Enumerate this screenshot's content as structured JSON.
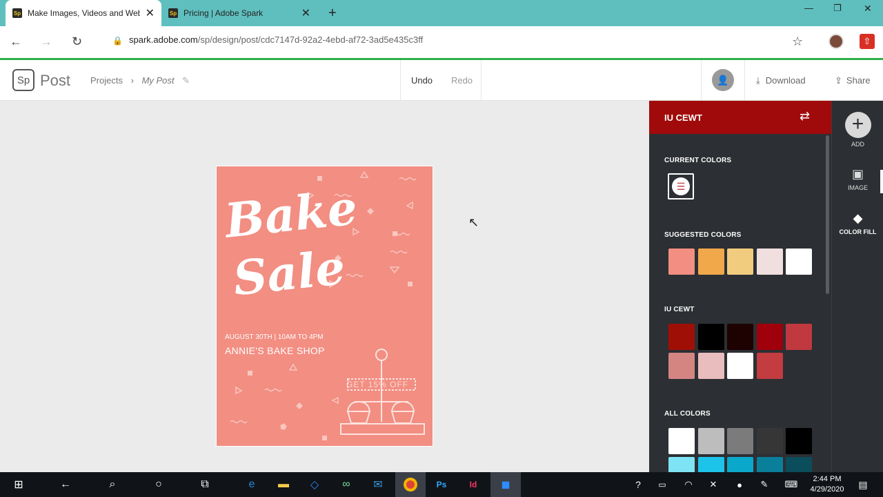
{
  "browser": {
    "tabs": [
      {
        "title": "Make Images, Videos and Web",
        "favicon": "Sp"
      },
      {
        "title": "Pricing | Adobe Spark",
        "favicon": "Sp"
      }
    ],
    "new_tab": "+",
    "url_host": "spark.adobe.com",
    "url_path": "/sp/design/post/cdc7147d-92a2-4ebd-af72-3ad5e435c3ff",
    "colors": {
      "tabbar": "#5fbfbf",
      "progress": "#2fb04b"
    }
  },
  "app": {
    "logo": "Sp",
    "logo_text": "Post",
    "breadcrumb": {
      "parent": "Projects",
      "separator": "›",
      "current": "My Post"
    },
    "undo": "Undo",
    "redo": "Redo",
    "download": "Download",
    "share": "Share"
  },
  "poster": {
    "title_line1": "Bake",
    "title_line2": "Sale",
    "date_line": "AUGUST 30TH | 10AM TO 4PM",
    "shop_line": "ANNIE'S BAKE SHOP",
    "promo": "GET 15% OFF",
    "background": "#f28e82"
  },
  "panel": {
    "title": "IU CEWT",
    "current_label": "CURRENT COLORS",
    "current_colors": [
      "#f28e82"
    ],
    "suggested_label": "SUGGESTED COLORS",
    "suggested_colors": [
      "#f28e82",
      "#f0a84a",
      "#f2cc7e",
      "#f1dede",
      "#ffffff"
    ],
    "theme_label": "IU CEWT",
    "theme_colors": [
      "#a00f05",
      "#000000",
      "#1e0202",
      "#a0000b",
      "#c0393f",
      "#d48582",
      "#e9bdbd",
      "#ffffff",
      "#c23c40"
    ],
    "all_label": "ALL COLORS",
    "all_colors": [
      "#ffffff",
      "#bdbdbd",
      "#7b7b7b",
      "#363636",
      "#000000",
      "#7ee3f5",
      "#1ec3ea",
      "#0aa9cc",
      "#0a7f99",
      "#0b4d5a"
    ]
  },
  "rail": [
    {
      "label": "ADD",
      "icon": "plus-circle-icon"
    },
    {
      "label": "IMAGE",
      "icon": "image-icon"
    },
    {
      "label": "COLOR FILL",
      "icon": "paint-bucket-icon"
    }
  ],
  "taskbar": {
    "time": "2:44 PM",
    "date": "4/29/2020"
  }
}
